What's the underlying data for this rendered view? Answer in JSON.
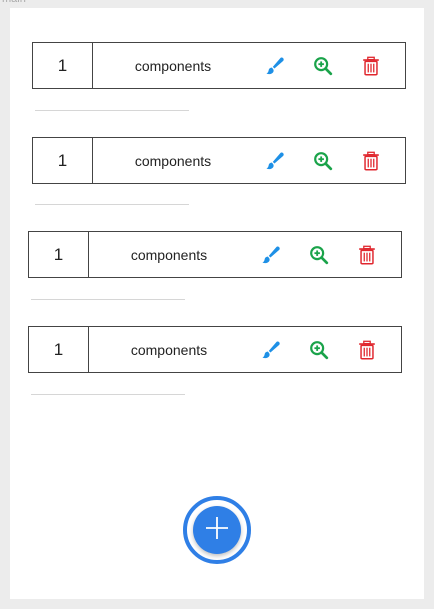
{
  "window": {
    "title": "main"
  },
  "colors": {
    "accent": "#2f7fe6",
    "edit": "#1e90e6",
    "zoom": "#1aa34a",
    "delete": "#e0262d"
  },
  "items": [
    {
      "count": "1",
      "label": "components",
      "icons": [
        "edit-brush-icon",
        "zoom-in-icon",
        "delete-trash-icon"
      ]
    },
    {
      "count": "1",
      "label": "components",
      "icons": [
        "edit-brush-icon",
        "zoom-in-icon",
        "delete-trash-icon"
      ]
    },
    {
      "count": "1",
      "label": "components",
      "icons": [
        "edit-brush-icon",
        "zoom-in-icon",
        "delete-trash-icon"
      ]
    },
    {
      "count": "1",
      "label": "components",
      "icons": [
        "edit-brush-icon",
        "zoom-in-icon",
        "delete-trash-icon"
      ]
    }
  ],
  "fab": {
    "icon": "plus-icon"
  }
}
